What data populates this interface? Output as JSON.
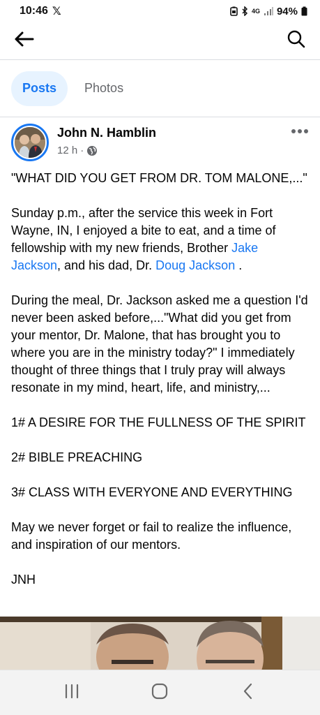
{
  "status_bar": {
    "time": "10:46",
    "x_logo": "𝕏",
    "network": "4G",
    "battery": "94%"
  },
  "app_bar": {
    "back_icon": "arrow-left-icon",
    "search_icon": "search-icon"
  },
  "tabs": [
    {
      "label": "Posts",
      "active": true
    },
    {
      "label": "Photos",
      "active": false
    }
  ],
  "post": {
    "author": "John N. Hamblin",
    "time": "12 h",
    "separator": "·",
    "privacy_icon": "globe-icon",
    "more_icon": "more-horizontal-icon",
    "paragraphs": {
      "p1": "\"WHAT DID YOU GET FROM DR. TOM MALONE,...\"",
      "p2_a": "Sunday p.m., after the service this week in Fort Wayne, IN, I enjoyed a bite to eat, and a time of fellowship with my new friends, Brother ",
      "p2_link1": "Jake Jackson",
      "p2_b": ", and his dad, Dr. ",
      "p2_link2": "Doug Jackson",
      "p2_c": " .",
      "p3": "During the meal, Dr. Jackson asked me a question I'd never been asked before,...\"What did you get from your mentor, Dr. Malone, that has brought you to where you are in the ministry today?\" I immediately thought of three things that I truly pray will always resonate in my mind, heart, life, and ministry,...",
      "p4": "1# A DESIRE FOR THE FULLNESS OF THE SPIRIT",
      "p5": "2# BIBLE PREACHING",
      "p6": "3# CLASS WITH EVERYONE AND EVERYTHING",
      "p7": "May we never forget or fail to realize the influence, and inspiration of our mentors.",
      "p8": "JNH"
    }
  },
  "nav_bar": {
    "recents_icon": "recent-apps-icon",
    "home_icon": "home-icon",
    "back_icon": "back-chevron-icon"
  },
  "colors": {
    "accent": "#1877f2",
    "tab_active_bg": "#e7f3ff",
    "secondary_text": "#65676b"
  }
}
